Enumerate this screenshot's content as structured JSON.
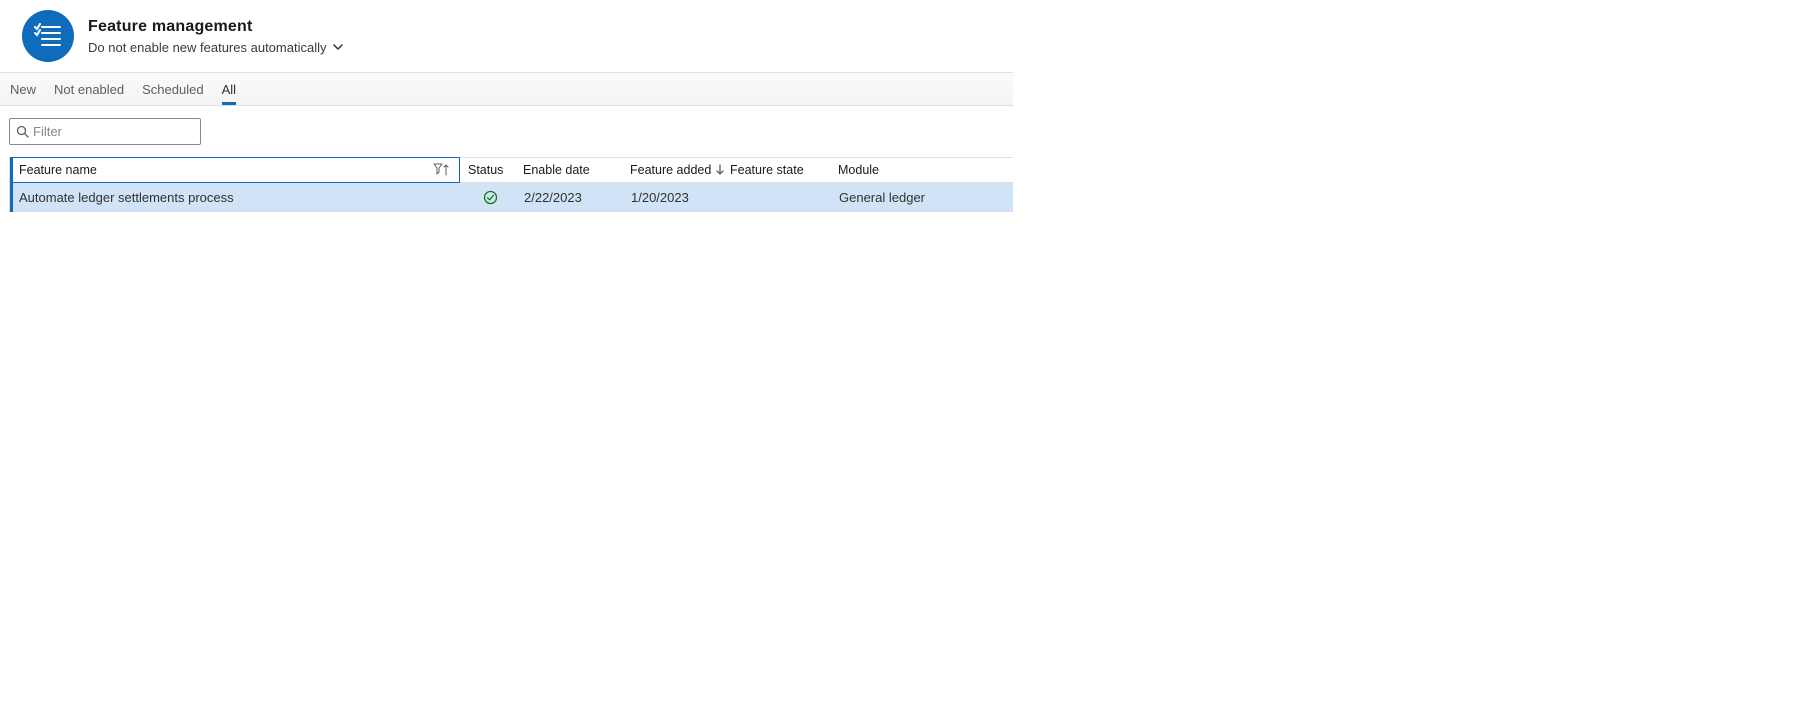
{
  "header": {
    "title": "Feature management",
    "subtitle": "Do not enable new features automatically"
  },
  "tabs": {
    "items": [
      {
        "label": "New"
      },
      {
        "label": "Not enabled"
      },
      {
        "label": "Scheduled"
      },
      {
        "label": "All"
      }
    ],
    "active_index": 3
  },
  "filter": {
    "placeholder": "Filter",
    "value": ""
  },
  "grid": {
    "columns": {
      "feature_name": "Feature name",
      "status": "Status",
      "enable_date": "Enable date",
      "feature_added": "Feature added",
      "feature_state": "Feature state",
      "module": "Module"
    },
    "rows": [
      {
        "feature_name": "Automate ledger settlements process",
        "status": "enabled",
        "enable_date": "2/22/2023",
        "feature_added": "1/20/2023",
        "feature_state": "",
        "module": "General ledger"
      }
    ]
  }
}
